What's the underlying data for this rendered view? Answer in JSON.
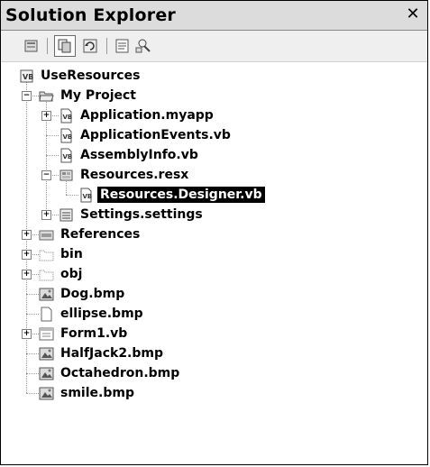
{
  "window": {
    "title": "Solution Explorer",
    "close_glyph": "✕"
  },
  "toolbar": {
    "buttons": [
      {
        "name": "properties-icon",
        "glyph": "▭"
      },
      {
        "name": "show-all-files-icon",
        "glyph": "▣"
      },
      {
        "name": "refresh-icon",
        "glyph": "⟳"
      },
      {
        "name": "view-code-icon",
        "glyph": "≡"
      },
      {
        "name": "class-diagram-icon",
        "glyph": "⚲"
      }
    ]
  },
  "tree": {
    "items": [
      {
        "label": "UseResources",
        "icon": "vb-project-icon",
        "level": 0,
        "expander": null,
        "selected": false
      },
      {
        "label": "My Project",
        "icon": "folder-open-icon",
        "level": 1,
        "expander": "-",
        "selected": false
      },
      {
        "label": "Application.myapp",
        "icon": "vb-file-icon",
        "level": 2,
        "expander": "+",
        "selected": false
      },
      {
        "label": "ApplicationEvents.vb",
        "icon": "vb-file-icon",
        "level": 2,
        "expander": null,
        "selected": false
      },
      {
        "label": "AssemblyInfo.vb",
        "icon": "vb-file-icon",
        "level": 2,
        "expander": null,
        "selected": false
      },
      {
        "label": "Resources.resx",
        "icon": "resource-file-icon",
        "level": 2,
        "expander": "-",
        "selected": false
      },
      {
        "label": "Resources.Designer.vb",
        "icon": "vb-file-icon",
        "level": 3,
        "expander": null,
        "selected": true
      },
      {
        "label": "Settings.settings",
        "icon": "settings-file-icon",
        "level": 2,
        "expander": "+",
        "selected": false
      },
      {
        "label": "References",
        "icon": "references-icon",
        "level": 1,
        "expander": "+",
        "selected": false
      },
      {
        "label": "bin",
        "icon": "folder-icon",
        "level": 1,
        "expander": "+",
        "selected": false
      },
      {
        "label": "obj",
        "icon": "folder-icon",
        "level": 1,
        "expander": "+",
        "selected": false
      },
      {
        "label": "Dog.bmp",
        "icon": "bitmap-icon",
        "level": 1,
        "expander": null,
        "selected": false
      },
      {
        "label": "ellipse.bmp",
        "icon": "blank-file-icon",
        "level": 1,
        "expander": null,
        "selected": false
      },
      {
        "label": "Form1.vb",
        "icon": "form-icon",
        "level": 1,
        "expander": "+",
        "selected": false
      },
      {
        "label": "HalfJack2.bmp",
        "icon": "bitmap-icon",
        "level": 1,
        "expander": null,
        "selected": false
      },
      {
        "label": "Octahedron.bmp",
        "icon": "bitmap-icon",
        "level": 1,
        "expander": null,
        "selected": false
      },
      {
        "label": "smile.bmp",
        "icon": "bitmap-icon",
        "level": 1,
        "expander": null,
        "selected": false
      }
    ]
  }
}
